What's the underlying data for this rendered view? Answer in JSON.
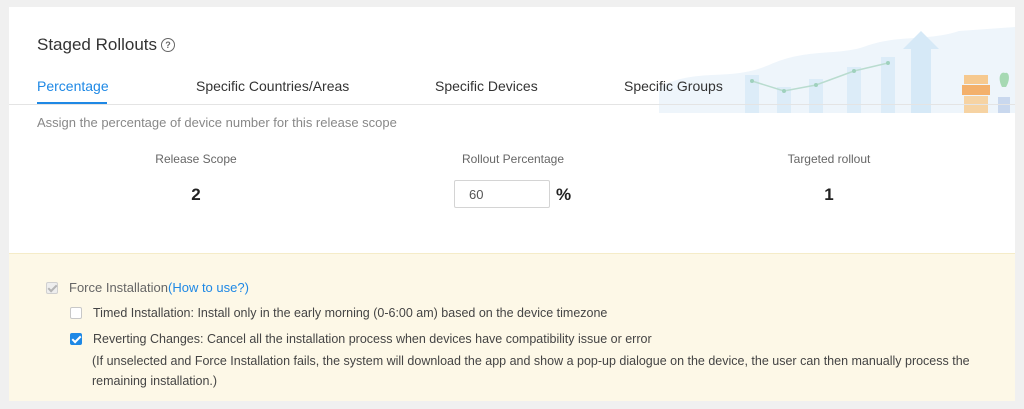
{
  "header": {
    "title": "Staged Rollouts",
    "help_icon": "question-circle-icon"
  },
  "tabs": [
    {
      "label": "Percentage",
      "active": true
    },
    {
      "label": "Specific Countries/Areas",
      "active": false
    },
    {
      "label": "Specific Devices",
      "active": false
    },
    {
      "label": "Specific Groups",
      "active": false
    }
  ],
  "description": "Assign the percentage of device number for this release scope",
  "columns": {
    "release_scope": {
      "label": "Release Scope",
      "value": "2"
    },
    "rollout_percentage": {
      "label": "Rollout Percentage",
      "value": "60",
      "unit": "%"
    },
    "targeted_rollout": {
      "label": "Targeted rollout",
      "value": "1"
    }
  },
  "options": {
    "force_installation": {
      "label": "Force Installation",
      "link": "(How to use?)",
      "checked": true,
      "disabled": true
    },
    "timed_installation": {
      "label": "Timed Installation: Install only in the early morning (0-6:00 am) based on the device timezone",
      "checked": false
    },
    "reverting_changes": {
      "label": "Reverting Changes: Cancel all the installation process when devices have compatibility issue or error",
      "checked": true,
      "note": "(If unselected and Force Installation fails, the system will download the app and show a pop-up dialogue on the device, the user can then manually process the remaining installation.)"
    }
  },
  "colors": {
    "accent": "#1e88e5",
    "options_background": "#fdf8e7"
  }
}
